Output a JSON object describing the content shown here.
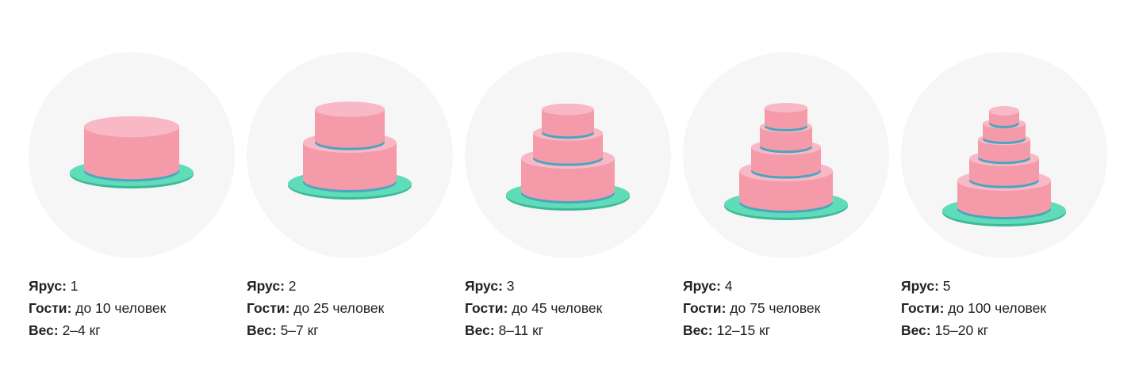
{
  "colors": {
    "circle_bg": "#f6f6f6",
    "plate": "#5fdcb8",
    "plate_rim": "#3eb79a",
    "band": "#4aa6c0",
    "cake_side": "#f59aa8",
    "cake_top": "#f9b8c6"
  },
  "cakes": [
    {
      "tiers": 1,
      "icon": "one-tier-cake-icon",
      "tier_label": "Ярус:",
      "tier_value": "1",
      "guests_label": "Гости:",
      "guests_value": "до 10 человек",
      "weight_label": "Вес:",
      "weight_value": "2–4 кг"
    },
    {
      "tiers": 2,
      "icon": "two-tier-cake-icon",
      "tier_label": "Ярус:",
      "tier_value": "2",
      "guests_label": "Гости:",
      "guests_value": "до 25 человек",
      "weight_label": "Вес:",
      "weight_value": "5–7 кг"
    },
    {
      "tiers": 3,
      "icon": "three-tier-cake-icon",
      "tier_label": "Ярус:",
      "tier_value": "3",
      "guests_label": "Гости:",
      "guests_value": "до 45 человек",
      "weight_label": "Вес:",
      "weight_value": "8–11 кг"
    },
    {
      "tiers": 4,
      "icon": "four-tier-cake-icon",
      "tier_label": "Ярус:",
      "tier_value": "4",
      "guests_label": "Гости:",
      "guests_value": "до 75 человек",
      "weight_label": "Вес:",
      "weight_value": "12–15 кг"
    },
    {
      "tiers": 5,
      "icon": "five-tier-cake-icon",
      "tier_label": "Ярус:",
      "tier_value": "5",
      "guests_label": "Гости:",
      "guests_value": "до 100 человек",
      "weight_label": "Вес:",
      "weight_value": "15–20 кг"
    }
  ]
}
